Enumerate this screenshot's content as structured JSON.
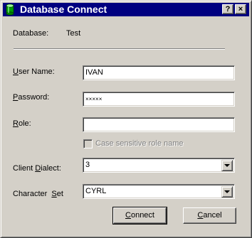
{
  "window": {
    "title": "Database Connect",
    "help_button": "?",
    "close_button": "×"
  },
  "info": {
    "database_label": "Database:",
    "database_value": "Test"
  },
  "form": {
    "user_name": {
      "label_prefix": "",
      "label_mnemonic": "U",
      "label_suffix": "ser Name:",
      "value": "IVAN"
    },
    "password": {
      "label_prefix": "",
      "label_mnemonic": "P",
      "label_suffix": "assword:",
      "value": "×××××"
    },
    "role": {
      "label_prefix": "",
      "label_mnemonic": "R",
      "label_suffix": "ole:",
      "value": ""
    },
    "case_sensitive": {
      "label": "Case sensitive role name",
      "checked": false,
      "enabled": false
    },
    "client_dialect": {
      "label_prefix": "Client ",
      "label_mnemonic": "D",
      "label_suffix": "ialect:",
      "value": "3"
    },
    "character_set": {
      "label_prefix": "Character  ",
      "label_mnemonic": "S",
      "label_suffix": "et",
      "value": "CYRL"
    }
  },
  "buttons": {
    "connect": {
      "mnemonic": "C",
      "rest": "onnect"
    },
    "cancel": {
      "mnemonic": "C",
      "rest": "ancel"
    }
  },
  "colors": {
    "titlebar": "#000080",
    "face": "#d4d0c8",
    "field_bg": "#ffffff",
    "disabled_text": "#808080"
  },
  "icons": {
    "title_icon": "database-icon",
    "dropdown_arrow": "chevron-down-icon"
  }
}
